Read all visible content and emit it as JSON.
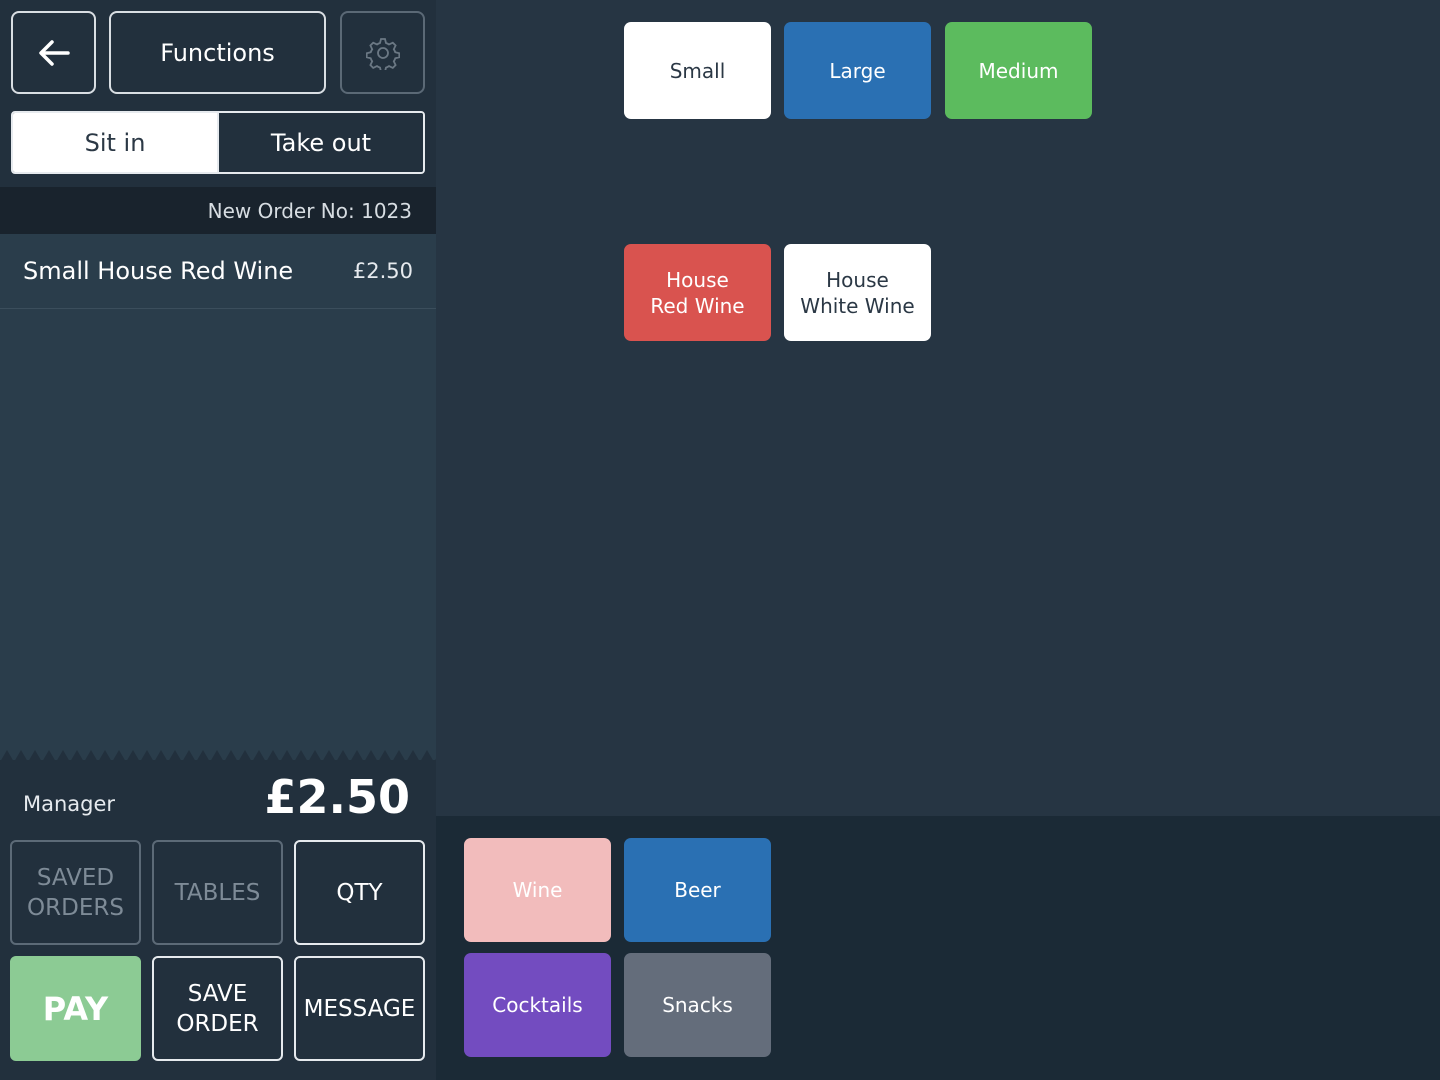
{
  "header": {
    "back_icon": "arrow-left-icon",
    "functions_label": "Functions",
    "settings_icon": "gear-icon"
  },
  "order_type": {
    "options": [
      "Sit in",
      "Take out"
    ],
    "selected": "Sit in"
  },
  "order": {
    "header_text": "New Order No: 1023",
    "items": [
      {
        "name": "Small House Red Wine",
        "price": "£2.50"
      }
    ],
    "user": "Manager",
    "total": "£2.50"
  },
  "actions": {
    "saved_orders": "SAVED\nORDERS",
    "tables": "TABLES",
    "qty": "QTY",
    "pay": "PAY",
    "save_order": "SAVE\nORDER",
    "message": "MESSAGE"
  },
  "size_options": [
    {
      "label": "Small",
      "color": "#ffffff"
    },
    {
      "label": "Large",
      "color": "#2a70b3"
    },
    {
      "label": "Medium",
      "color": "#5cbb5e"
    }
  ],
  "products": [
    {
      "label": "House\nRed Wine",
      "color": "#d9534f"
    },
    {
      "label": "House\nWhite Wine",
      "color": "#ffffff"
    }
  ],
  "categories": [
    {
      "label": "Wine",
      "color": "#f2bcbc"
    },
    {
      "label": "Beer",
      "color": "#2a70b3"
    },
    {
      "label": "Cocktails",
      "color": "#734cc0"
    },
    {
      "label": "Snacks",
      "color": "#646d7b"
    }
  ]
}
